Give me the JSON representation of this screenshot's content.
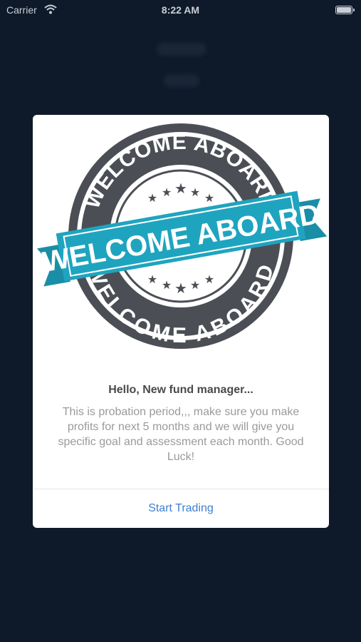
{
  "status_bar": {
    "carrier": "Carrier",
    "time": "8:22 AM",
    "wifi_icon": "wifi-icon",
    "battery_icon": "battery-icon"
  },
  "dialog": {
    "badge": {
      "top_text": "WELCOME ABOARD",
      "ribbon_text": "WELCOME ABOARD",
      "bottom_text": "WELCOME ABOARD",
      "seal_color": "#4b4f55",
      "ribbon_color": "#1fa4bf"
    },
    "greeting": "Hello, New fund manager...",
    "message": "This is probation period,,, make sure you make profits for next 5 months and we will give you specific goal and assessment each month. Good Luck!",
    "button_label": "Start Trading",
    "accent_color": "#3f7fd1"
  }
}
